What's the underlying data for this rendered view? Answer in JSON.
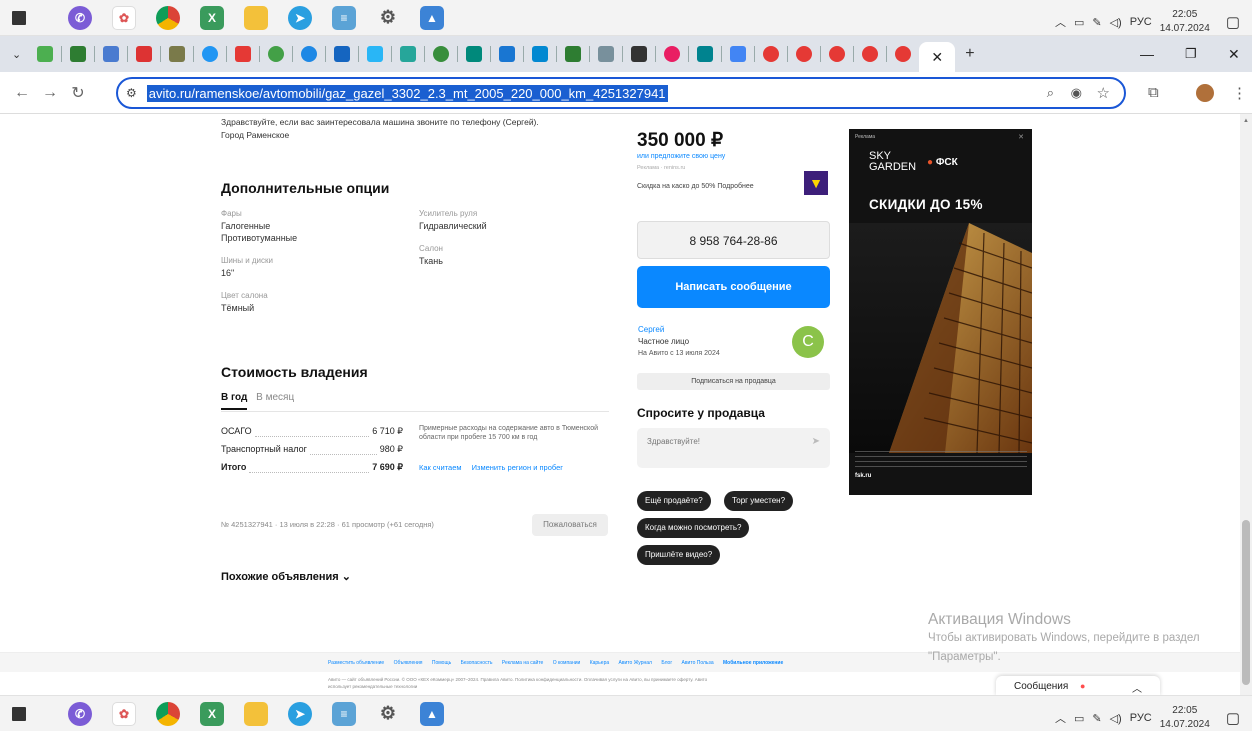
{
  "taskbar": {
    "lang": "РУС",
    "time": "22:05",
    "date": "14.07.2024"
  },
  "address": {
    "url": "avito.ru/ramenskoe/avtomobili/gaz_gazel_3302_2.3_mt_2005_220_000_km_4251327941"
  },
  "description": {
    "line1": "Здравствуйте, если вас заинтересовала машина звоните по телефону (Сергей).",
    "line2": "Город Раменское"
  },
  "options": {
    "title": "Дополнительные опции",
    "headlights_label": "Фары",
    "headlights_v1": "Галогенные",
    "headlights_v2": "Противотуманные",
    "wheels_label": "Шины и диски",
    "wheels_value": "16\"",
    "color_label": "Цвет салона",
    "color_value": "Тёмный",
    "steering_label": "Усилитель руля",
    "steering_value": "Гидравлический",
    "salon_label": "Салон",
    "salon_value": "Ткань"
  },
  "ownership": {
    "title": "Стоимость владения",
    "tab_year": "В год",
    "tab_month": "В месяц",
    "osago_label": "ОСАГО",
    "osago_value": "6 710 ₽",
    "tax_label": "Транспортный налог",
    "tax_value": "980 ₽",
    "total_label": "Итого",
    "total_value": "7 690 ₽",
    "note": "Примерные расходы на содержание авто в Тюменской области при пробеге 15 700 км в год",
    "link_how": "Как считаем",
    "link_change": "Изменить регион и пробег"
  },
  "meta": {
    "info": "№ 4251327941 · 13 июля в 22:28 · 61 просмотр (+61 сегодня)",
    "report_button": "Пожаловаться"
  },
  "similar": {
    "title": "Похожие объявления"
  },
  "sidebar": {
    "price": "350 000 ₽",
    "price_link": "или предложите свою цену",
    "ad_label": "Реклама · renins.ru",
    "insurance_text": "Скидка на каско до 50% Подробнее",
    "phone": "8 958 764-28-86",
    "message_button": "Написать сообщение",
    "seller_name": "Сергей",
    "seller_type": "Частное лицо",
    "seller_since": "На Авито с 13 июля 2024",
    "avatar_letter": "С",
    "subscribe_button": "Подписаться на продавца",
    "ask_title": "Спросите у продавца",
    "ask_placeholder": "Здравствуйте!",
    "quick": [
      "Ещё продаёте?",
      "Торг уместен?",
      "Когда можно посмотреть?",
      "Пришлёте видео?"
    ]
  },
  "banner": {
    "label": "Реклама",
    "brand1": "SKY",
    "brand2": "GARDEN",
    "brand3": "ФСК",
    "headline": "СКИДКИ ДО 15%",
    "footer_brand": "fsk.ru"
  },
  "footer": {
    "links": [
      "Разместить объявление",
      "Объявления",
      "Помощь",
      "Безопасность",
      "Реклама на сайте",
      "О компании",
      "Карьера",
      "Авито Журнал",
      "Блог",
      "Авито Польза",
      "Мобильное приложение"
    ],
    "legal1": "Авито — сайт объявлений России. © ООО «КЕХ еКоммерц» 2007–2024. Правила Авито. Политика конфиденциальности. Оплачивая услуги на Авито, вы принимаете оферту. Авито",
    "legal2": "использует рекомендательные технологии"
  },
  "windows": {
    "activate_title": "Активация Windows",
    "activate_text": "Чтобы активировать Windows, перейдите в раздел \"Параметры\"."
  },
  "messages": {
    "label": "Сообщения"
  },
  "colors": {
    "primary": "#0a88ff",
    "accent_green": "#8bc34a",
    "dark_pill": "#222222",
    "ad_orange": "#e8542a"
  }
}
